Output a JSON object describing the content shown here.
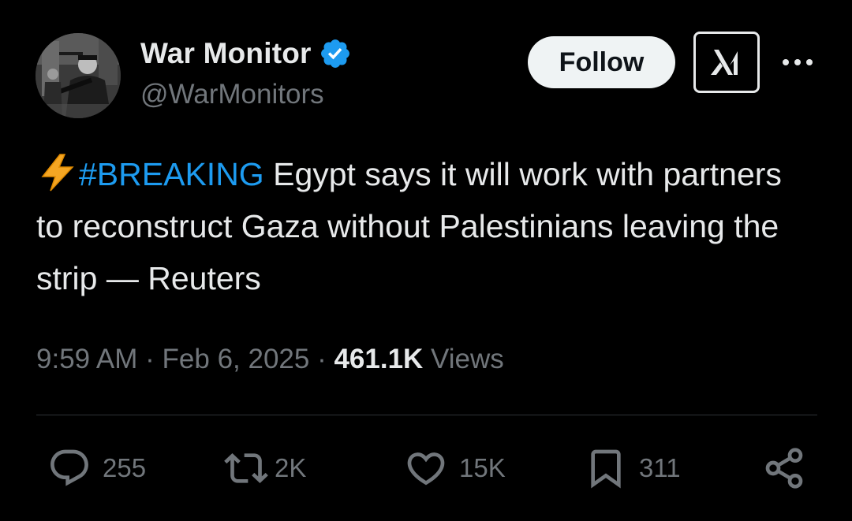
{
  "author": {
    "display_name": "War Monitor",
    "handle": "@WarMonitors",
    "verified": true
  },
  "header": {
    "follow_label": "Follow",
    "grok_icon": "grok-icon",
    "more_icon": "more-icon"
  },
  "tweet": {
    "emoji": "⚡",
    "hashtag": "#BREAKING",
    "text": " Egypt says it will work with partners to reconstruct Gaza without Palestinians leaving the strip — Reuters"
  },
  "meta": {
    "time": "9:59 AM",
    "separator1": " · ",
    "date": "Feb 6, 2025",
    "separator2": " · ",
    "views_count": "461.1K",
    "views_label": " Views"
  },
  "actions": {
    "replies": "255",
    "reposts": "2K",
    "likes": "15K",
    "bookmarks": "311"
  },
  "colors": {
    "background": "#000000",
    "text": "#e7e9ea",
    "secondary": "#71767b",
    "link": "#1d9bf0",
    "verified": "#1d9bf0",
    "divider": "#2f3336"
  }
}
